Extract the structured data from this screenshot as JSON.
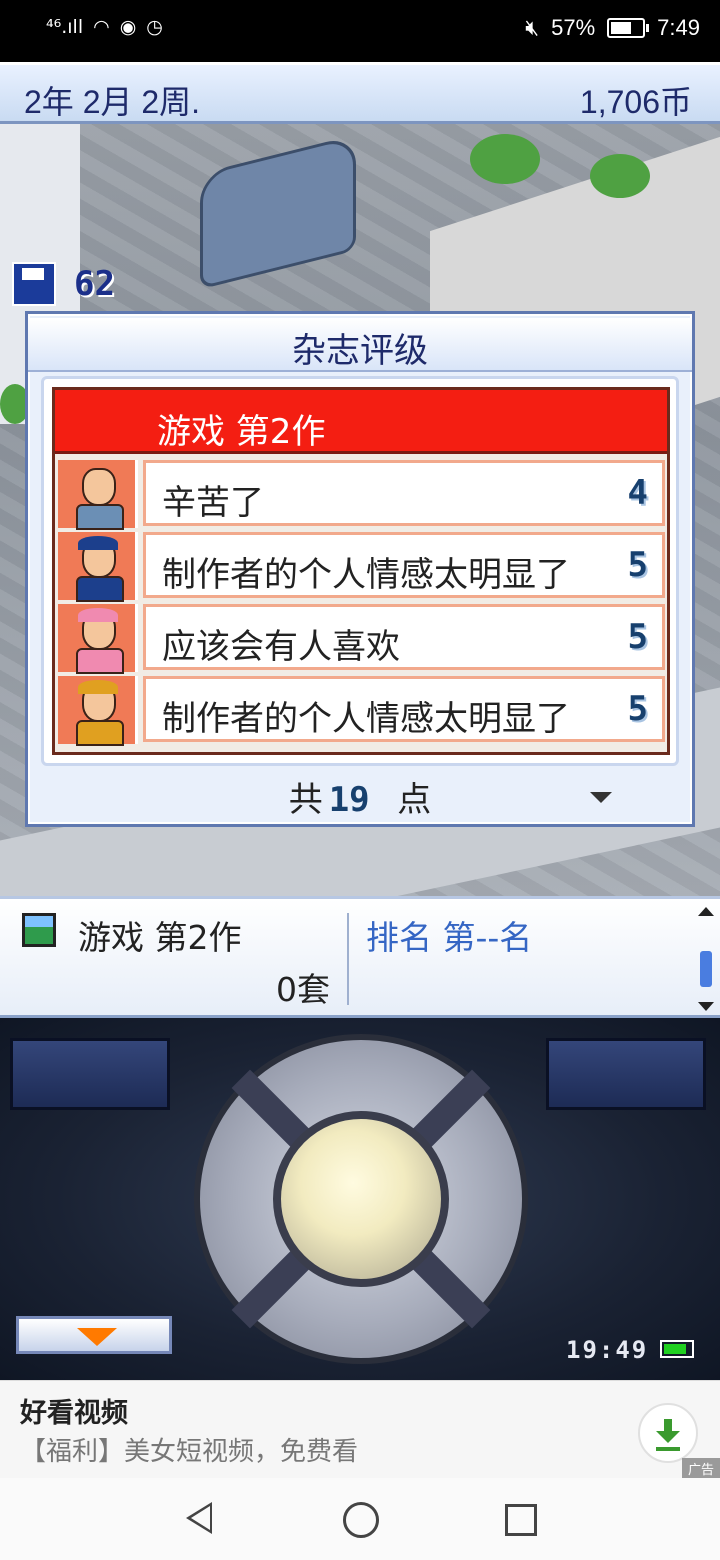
{
  "status_bar": {
    "network": "⁴⁶.ıll",
    "wifi_icon": "wifi-icon",
    "battery_percent": "57%",
    "battery_level": 0.57,
    "time": "7:49"
  },
  "top_bar": {
    "date": "2年 2月 2周.",
    "money": "1,706币"
  },
  "scene": {
    "save_count": "62"
  },
  "dialog": {
    "title": "杂志评级",
    "game_title": "游戏 第2作",
    "reviews": [
      {
        "comment": "辛苦了",
        "score": "4",
        "avatar_color": "#6b8fb5"
      },
      {
        "comment": "制作者的个人情感太明显了",
        "score": "5",
        "avatar_color": "#1c3f8c"
      },
      {
        "comment": "应该会有人喜欢",
        "score": "5",
        "avatar_color": "#f08ab0"
      },
      {
        "comment": "制作者的个人情感太明显了",
        "score": "5",
        "avatar_color": "#e0a020"
      }
    ],
    "total_prefix": "共",
    "total_value": "19",
    "total_suffix": "点"
  },
  "info_panel": {
    "game_name": "游戏 第2作",
    "sales": "0套",
    "rank": "排名 第--名"
  },
  "controller": {
    "clock": "19:49"
  },
  "ad": {
    "title": "好看视频",
    "description": "【福利】美女短视频，免费看",
    "tag": "广告"
  }
}
